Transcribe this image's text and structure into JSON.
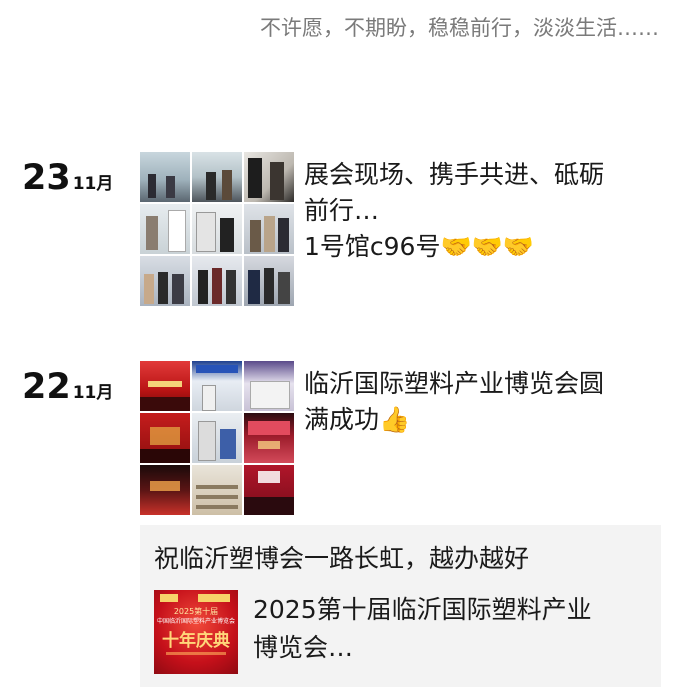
{
  "signature": "不许愿，不期盼，稳稳前行，淡淡生活……",
  "posts": [
    {
      "day": "23",
      "month": "11月",
      "text_line1": "展会现场、携手共进、砥砺",
      "text_line2": "前行…",
      "text_line3": "1号馆c96号",
      "emoji": "🤝🤝🤝",
      "emoji_name": "handshake-emoji",
      "photos": [
        "exhibition-photo",
        "exhibition-photo",
        "exhibition-photo",
        "exhibition-photo",
        "exhibition-photo",
        "exhibition-photo",
        "exhibition-photo",
        "exhibition-photo",
        "exhibition-photo"
      ]
    },
    {
      "day": "22",
      "month": "11月",
      "text_line1": "临沂国际塑料产业博览会圆",
      "text_line2": "满成功",
      "emoji": "👍",
      "emoji_name": "thumbs-up-emoji",
      "photos": [
        "expo-photo",
        "expo-photo",
        "expo-photo",
        "expo-photo",
        "expo-photo",
        "expo-photo",
        "expo-photo",
        "expo-photo",
        "expo-photo"
      ]
    }
  ],
  "share": {
    "caption": "祝临沂塑博会一路长虹，越办越好",
    "title_line1": "2025第十届临沂国际塑料产业",
    "title_line2": "博览会…",
    "thumb_text_top": "2025第十届",
    "thumb_text_mid": "中国临沂国际塑料产业博览会",
    "thumb_text_big": "十年庆典",
    "thumb_color": "#d7121a"
  }
}
